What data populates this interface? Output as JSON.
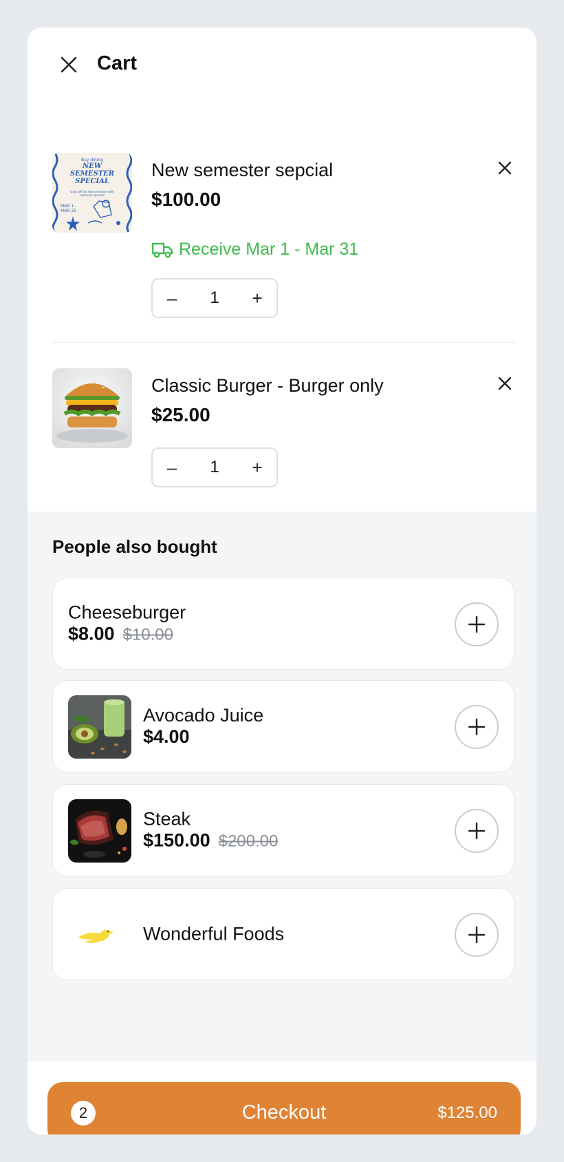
{
  "header": {
    "title": "Cart"
  },
  "cart": {
    "items": [
      {
        "name": "New semester sepcial",
        "price": "$100.00",
        "receive": "Receive Mar 1 - Mar 31",
        "qty": "1",
        "thumb_text": {
          "top": "Buy dining",
          "title": "NEW SEMESTER SPECIAL",
          "sub": "Grab off the new semester with exclusive specials",
          "dates": "MAR 1 - MAR 31"
        }
      },
      {
        "name": "Classic Burger - Burger only",
        "price": "$25.00",
        "qty": "1"
      }
    ],
    "stepper": {
      "minus": "–",
      "plus": "+"
    }
  },
  "recommendations": {
    "title": "People also bought",
    "items": [
      {
        "name": "Cheeseburger",
        "price": "$8.00",
        "old_price": "$10.00"
      },
      {
        "name": "Avocado Juice",
        "price": "$4.00"
      },
      {
        "name": "Steak",
        "price": "$150.00",
        "old_price": "$200.00"
      },
      {
        "name": "Wonderful Foods"
      }
    ]
  },
  "checkout": {
    "count": "2",
    "label": "Checkout",
    "total": "$125.00"
  },
  "colors": {
    "accent": "#df8334",
    "success": "#3dbb4d",
    "panel": "#f4f5f7"
  },
  "icons": [
    "close-icon",
    "remove-icon",
    "truck-icon",
    "minus-icon",
    "plus-icon"
  ]
}
